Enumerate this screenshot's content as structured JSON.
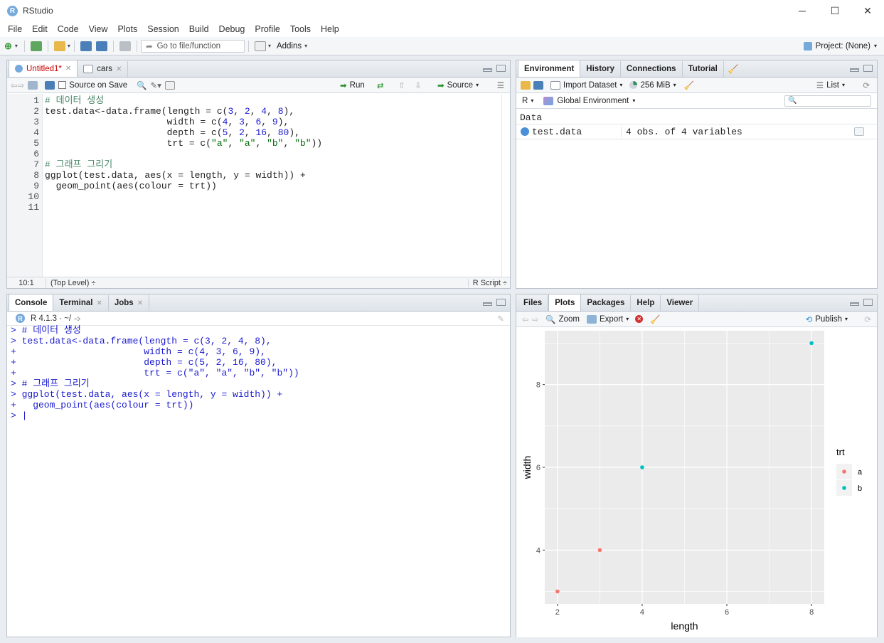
{
  "window": {
    "title": "RStudio",
    "min": "─",
    "max": "☐",
    "close": "✕"
  },
  "menu": [
    "File",
    "Edit",
    "Code",
    "View",
    "Plots",
    "Session",
    "Build",
    "Debug",
    "Profile",
    "Tools",
    "Help"
  ],
  "toolbar": {
    "goto_placeholder": "Go to file/function",
    "addins": "Addins",
    "project": "Project: (None)"
  },
  "editor": {
    "tabs": [
      {
        "label": "Untitled1*"
      },
      {
        "label": "cars"
      }
    ],
    "source_on_save": "Source on Save",
    "run": "Run",
    "source": "Source",
    "lines": [
      {
        "n": "1",
        "html": "<span class=\"comment\"># 데이터 생성</span>"
      },
      {
        "n": "2",
        "html": "test.data<-data.frame(length = c(<span class=\"num\">3</span>, <span class=\"num\">2</span>, <span class=\"num\">4</span>, <span class=\"num\">8</span>),"
      },
      {
        "n": "3",
        "html": "                      width = c(<span class=\"num\">4</span>, <span class=\"num\">3</span>, <span class=\"num\">6</span>, <span class=\"num\">9</span>),"
      },
      {
        "n": "4",
        "html": "                      depth = c(<span class=\"num\">5</span>, <span class=\"num\">2</span>, <span class=\"num\">16</span>, <span class=\"num\">80</span>),"
      },
      {
        "n": "5",
        "html": "                      trt = c(<span class=\"str\">\"a\"</span>, <span class=\"str\">\"a\"</span>, <span class=\"str\">\"b\"</span>, <span class=\"str\">\"b\"</span>))"
      },
      {
        "n": "6",
        "html": ""
      },
      {
        "n": "7",
        "html": "<span class=\"comment\"># 그래프 그리기</span>"
      },
      {
        "n": "8",
        "html": "ggplot(test.data, aes(x = length, y = width)) +"
      },
      {
        "n": "9",
        "html": "  geom_point(aes(colour = trt))"
      },
      {
        "n": "10",
        "html": ""
      },
      {
        "n": "11",
        "html": ""
      }
    ],
    "status_pos": "10:1",
    "status_level": "(Top Level) ÷",
    "status_type": "R Script ÷"
  },
  "console": {
    "tabs": [
      {
        "label": "Console"
      },
      {
        "label": "Terminal"
      },
      {
        "label": "Jobs"
      }
    ],
    "version": "R 4.1.3 · ~/",
    "lines": [
      "> # 데이터 생성",
      "> test.data<-data.frame(length = c(3, 2, 4, 8),",
      "+                       width = c(4, 3, 6, 9),",
      "+                       depth = c(5, 2, 16, 80),",
      "+                       trt = c(\"a\", \"a\", \"b\", \"b\"))",
      "> # 그래프 그리기",
      "> ggplot(test.data, aes(x = length, y = width)) +",
      "+   geom_point(aes(colour = trt))",
      "> |"
    ]
  },
  "environment": {
    "tabs": [
      {
        "label": "Environment"
      },
      {
        "label": "History"
      },
      {
        "label": "Connections"
      },
      {
        "label": "Tutorial"
      }
    ],
    "import_dataset": "Import Dataset",
    "memory": "256 MiB",
    "list": "List",
    "lang": "R",
    "scope": "Global Environment",
    "section": "Data",
    "rows": [
      {
        "name": "test.data",
        "value": "4 obs. of 4 variables"
      }
    ]
  },
  "files": {
    "tabs": [
      {
        "label": "Files"
      },
      {
        "label": "Plots"
      },
      {
        "label": "Packages"
      },
      {
        "label": "Help"
      },
      {
        "label": "Viewer"
      }
    ],
    "zoom": "Zoom",
    "export": "Export",
    "publish": "Publish"
  },
  "chart_data": {
    "type": "scatter",
    "xlabel": "length",
    "ylabel": "width",
    "xlim": [
      1.7,
      8.3
    ],
    "ylim": [
      2.7,
      9.3
    ],
    "xticks": [
      2,
      4,
      6,
      8
    ],
    "yticks": [
      4,
      6,
      8
    ],
    "grid": true,
    "legend": {
      "title": "trt",
      "position": "right"
    },
    "series": [
      {
        "name": "a",
        "color": "#F8766D",
        "points": [
          {
            "x": 3,
            "y": 4
          },
          {
            "x": 2,
            "y": 3
          }
        ]
      },
      {
        "name": "b",
        "color": "#00BFC4",
        "points": [
          {
            "x": 4,
            "y": 6
          },
          {
            "x": 8,
            "y": 9
          }
        ]
      }
    ]
  }
}
